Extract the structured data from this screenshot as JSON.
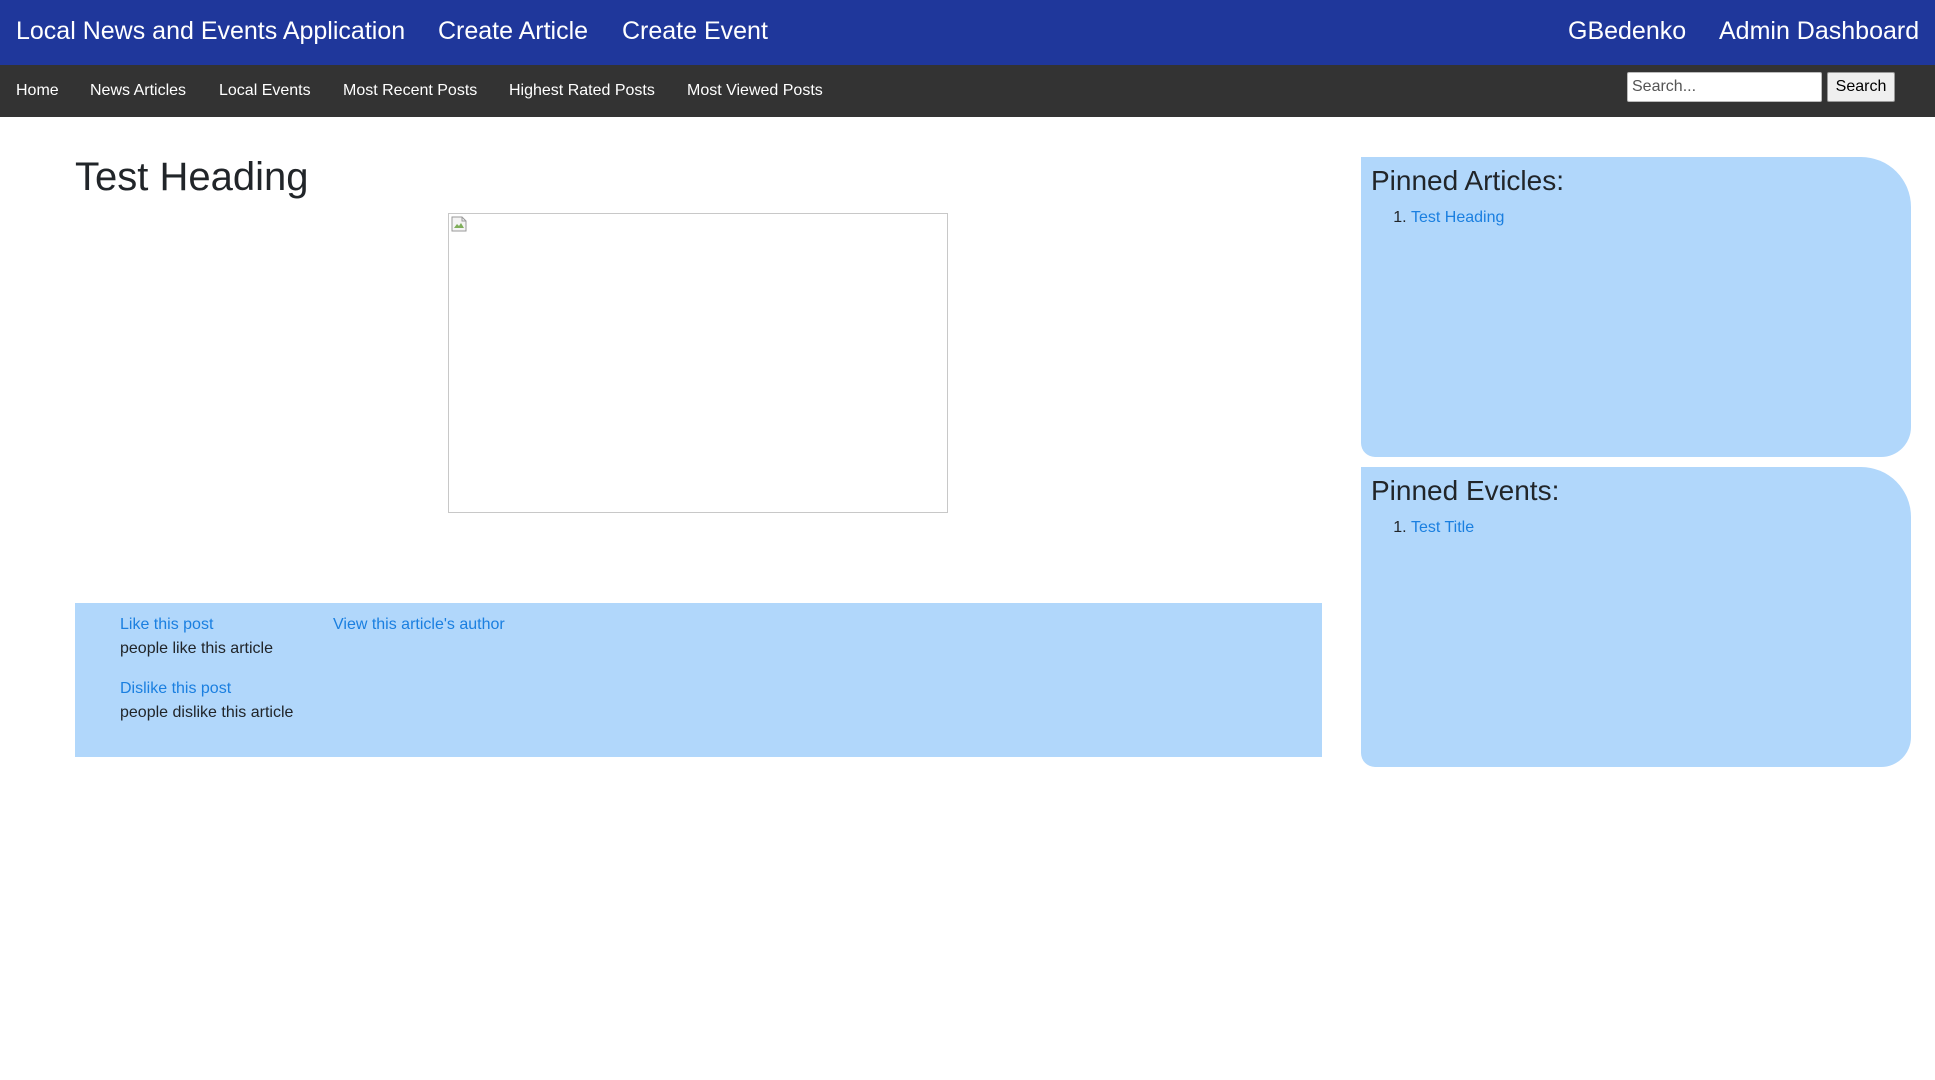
{
  "topnav": {
    "brand": "Local News and Events Application",
    "create_article": "Create Article",
    "create_event": "Create Event",
    "username": "GBedenko",
    "admin_dashboard": "Admin Dashboard"
  },
  "subnav": {
    "items": [
      "Home",
      "News Articles",
      "Local Events",
      "Most Recent Posts",
      "Highest Rated Posts",
      "Most Viewed Posts"
    ],
    "search_placeholder": "Search...",
    "search_button": "Search"
  },
  "article": {
    "title": "Test Heading",
    "like_link": "Like this post",
    "like_count_text": "people like this article",
    "dislike_link": "Dislike this post",
    "dislike_count_text": "people dislike this article",
    "author_link": "View this article's author"
  },
  "pinned_articles": {
    "heading": "Pinned Articles:",
    "items": [
      "Test Heading"
    ]
  },
  "pinned_events": {
    "heading": "Pinned Events:",
    "items": [
      "Test Title"
    ]
  },
  "colors": {
    "topbar": "#1f379b",
    "subnav": "#333333",
    "panel": "#b1d7fb",
    "link": "#1a7fe0"
  }
}
